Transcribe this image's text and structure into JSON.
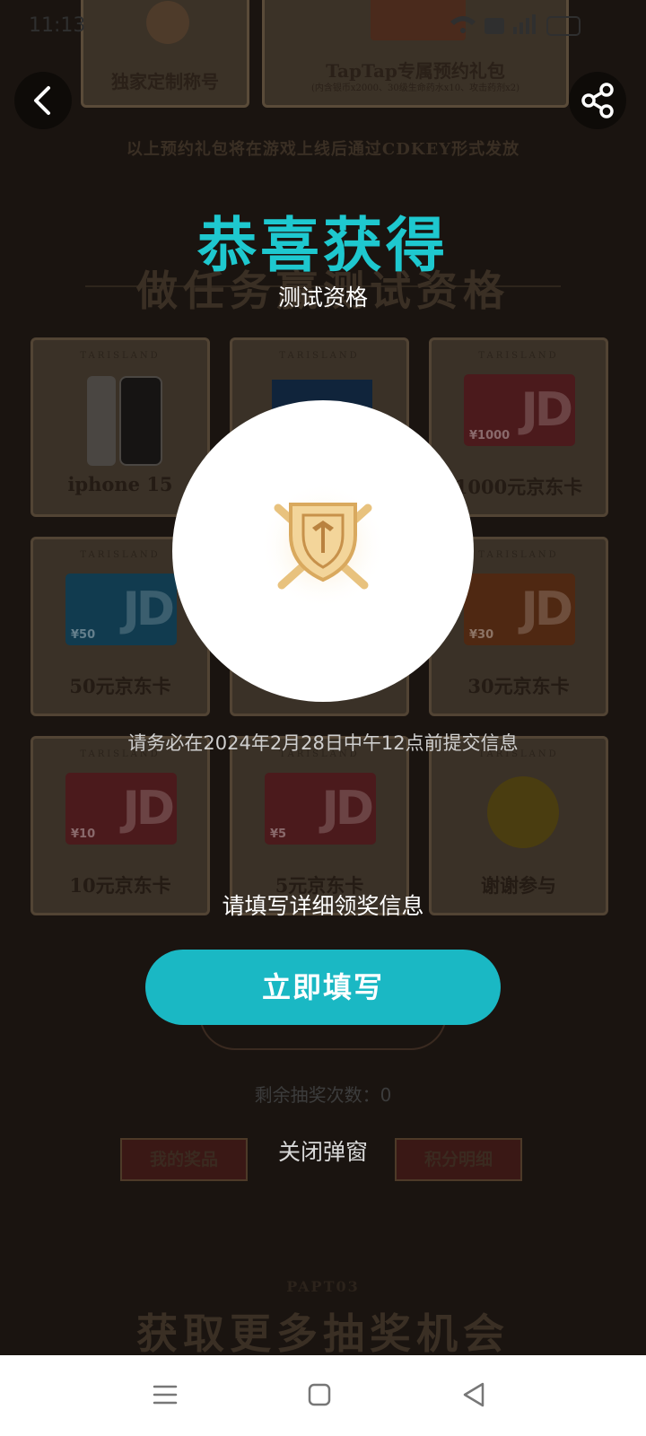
{
  "status_bar": {
    "time": "11:13"
  },
  "background": {
    "gift_cards": [
      {
        "name": "独家定制称号"
      },
      {
        "name": "TapTap专属预约礼包",
        "detail": "(内含银币x2000、30级生命药水x10、攻击药剂x2)"
      }
    ],
    "notice": "以上预约礼包将在游戏上线后通过CDKEY形式发放",
    "section_title": "做任务赢测试资格",
    "tile_brand": "TARISLAND",
    "prizes": [
      {
        "label": "iphone 15"
      },
      {
        "label": ""
      },
      {
        "label": "1000元京东卡",
        "amount": "¥1000"
      },
      {
        "label": "50元京东卡",
        "amount": "¥50"
      },
      {
        "label": ""
      },
      {
        "label": "30元京东卡",
        "amount": "¥30"
      },
      {
        "label": "10元京东卡",
        "amount": "¥10"
      },
      {
        "label": "5元京东卡",
        "amount": "¥5"
      },
      {
        "label": "谢谢参与"
      }
    ],
    "my_prizes": "我的奖品",
    "points_detail": "积分明细",
    "part_label": "PAPT03",
    "more_chances_title": "获取更多抽奖机会"
  },
  "modal": {
    "title": "恭喜获得",
    "prize": "测试资格",
    "deadline_note": "请务必在2024年2月28日中午12点前提交信息",
    "fill_prompt": "请填写详细领奖信息",
    "fill_button": "立即填写",
    "draws_left": "剩余抽奖次数：0",
    "close": "关闭弹窗"
  },
  "colors": {
    "accent": "#1ec8cf",
    "button": "#1ab8c4"
  },
  "icons": {
    "back": "chevron-left-icon",
    "share": "share-icon",
    "prize": "shield-swords-icon",
    "nav": [
      "menu-icon",
      "home-square-icon",
      "back-triangle-icon"
    ]
  }
}
